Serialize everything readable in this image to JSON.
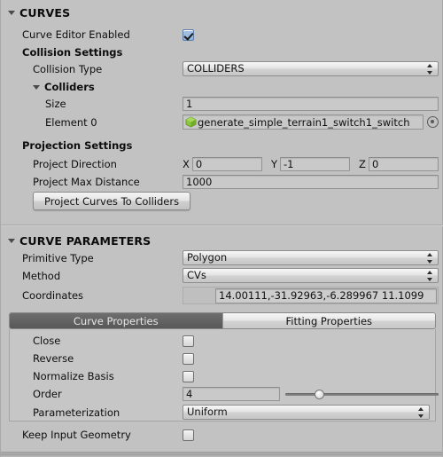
{
  "colors": {
    "panel_bg": "#c2c2c2",
    "field_bg": "#c9c9c9",
    "accent_checkbox": "#9cbbde",
    "tab_active_bg": "#5f5f5f",
    "prefab_icon": "#8cc63f"
  },
  "curves_section": {
    "title": "CURVES",
    "foldout_icon": "triangle-down-icon",
    "curve_editor_enabled": {
      "label": "Curve Editor Enabled",
      "checked": true
    },
    "collision_settings": {
      "label": "Collision Settings",
      "collision_type": {
        "label": "Collision Type",
        "value": "COLLIDERS",
        "dropdown_icon": "updown-arrows-icon"
      },
      "colliders": {
        "label": "Colliders",
        "foldout_icon": "triangle-down-icon",
        "size": {
          "label": "Size",
          "value": "1"
        },
        "element0": {
          "label": "Element 0",
          "value": "generate_simple_terrain1_switch1_switch",
          "object_icon": "prefab-cube-icon",
          "picker_icon": "object-picker-icon"
        }
      }
    },
    "projection_settings": {
      "label": "Projection Settings",
      "project_direction": {
        "label": "Project Direction",
        "axes": [
          {
            "name": "X",
            "value": "0"
          },
          {
            "name": "Y",
            "value": "-1"
          },
          {
            "name": "Z",
            "value": "0"
          }
        ]
      },
      "project_max_distance": {
        "label": "Project Max Distance",
        "value": "1000"
      },
      "project_button": "Project Curves To Colliders"
    }
  },
  "curve_parameters_section": {
    "title": "CURVE PARAMETERS",
    "foldout_icon": "triangle-down-icon",
    "primitive_type": {
      "label": "Primitive Type",
      "value": "Polygon",
      "dropdown_icon": "updown-arrows-icon"
    },
    "method": {
      "label": "Method",
      "value": "CVs",
      "dropdown_icon": "updown-arrows-icon"
    },
    "coordinates": {
      "label": "Coordinates",
      "value": "14.00111,-31.92963,-6.289967 11.1099"
    },
    "tabs": [
      {
        "label": "Curve Properties",
        "active": true
      },
      {
        "label": "Fitting Properties",
        "active": false
      }
    ],
    "curve_properties": {
      "close": {
        "label": "Close",
        "checked": false
      },
      "reverse": {
        "label": "Reverse",
        "checked": false
      },
      "normalize_basis": {
        "label": "Normalize Basis",
        "checked": false
      },
      "order": {
        "label": "Order",
        "value": "4",
        "slider_percent": 22
      },
      "parameterization": {
        "label": "Parameterization",
        "value": "Uniform",
        "dropdown_icon": "updown-arrows-icon"
      }
    },
    "keep_input_geometry": {
      "label": "Keep Input Geometry",
      "checked": false
    }
  }
}
